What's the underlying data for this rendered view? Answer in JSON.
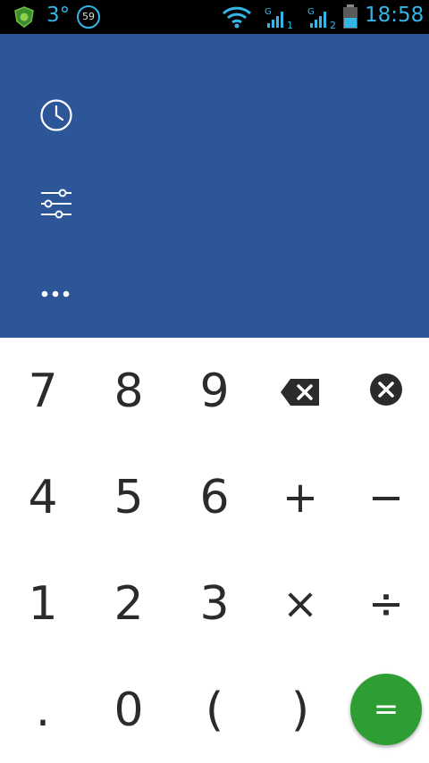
{
  "status_bar": {
    "temperature": "3°",
    "notification_count": "59",
    "sim1_label": "1",
    "sim2_label": "2",
    "time": "18:58",
    "accent_color": "#33b5e5"
  },
  "display": {
    "background_color": "#2c5697",
    "tools": [
      {
        "name": "history",
        "icon": "clock-icon"
      },
      {
        "name": "settings",
        "icon": "sliders-icon"
      },
      {
        "name": "more",
        "icon": "more-dots-icon"
      }
    ]
  },
  "keypad": {
    "rows": [
      [
        "7",
        "8",
        "9",
        "backspace",
        "clear"
      ],
      [
        "4",
        "5",
        "6",
        "+",
        "−"
      ],
      [
        "1",
        "2",
        "3",
        "×",
        "÷"
      ],
      [
        ".",
        "0",
        "(",
        ")",
        "="
      ]
    ],
    "equals_label": "=",
    "equals_color": "#2e9e34"
  }
}
